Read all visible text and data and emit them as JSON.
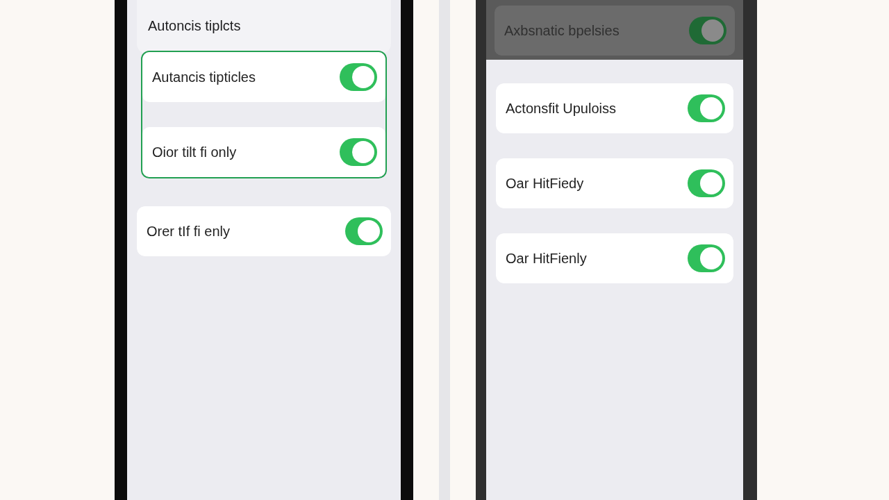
{
  "phones": [
    {
      "sections": [
        {
          "kind": "header",
          "title": "Autoncis tiplcts"
        },
        {
          "kind": "group",
          "highlighted": true,
          "rows": [
            {
              "label": "Autancis tipticles",
              "on": true
            },
            {
              "label": "Oior tilt fi only",
              "on": true
            }
          ]
        },
        {
          "kind": "group",
          "highlighted": false,
          "rows": [
            {
              "label": "Orer tIf fi enly",
              "on": true
            }
          ]
        }
      ]
    },
    {
      "sections": [
        {
          "kind": "dimmed",
          "rows": [
            {
              "label": "Axbsnatic bpelsies",
              "on": true
            }
          ]
        },
        {
          "kind": "group",
          "highlighted": false,
          "rows": [
            {
              "label": "Actonsfit Upuloiss",
              "on": true
            }
          ]
        },
        {
          "kind": "group",
          "highlighted": false,
          "rows": [
            {
              "label": "Oar HitFiedy",
              "on": true
            }
          ]
        },
        {
          "kind": "group",
          "highlighted": false,
          "rows": [
            {
              "label": "Oar HitFienly",
              "on": true
            }
          ]
        }
      ]
    }
  ]
}
